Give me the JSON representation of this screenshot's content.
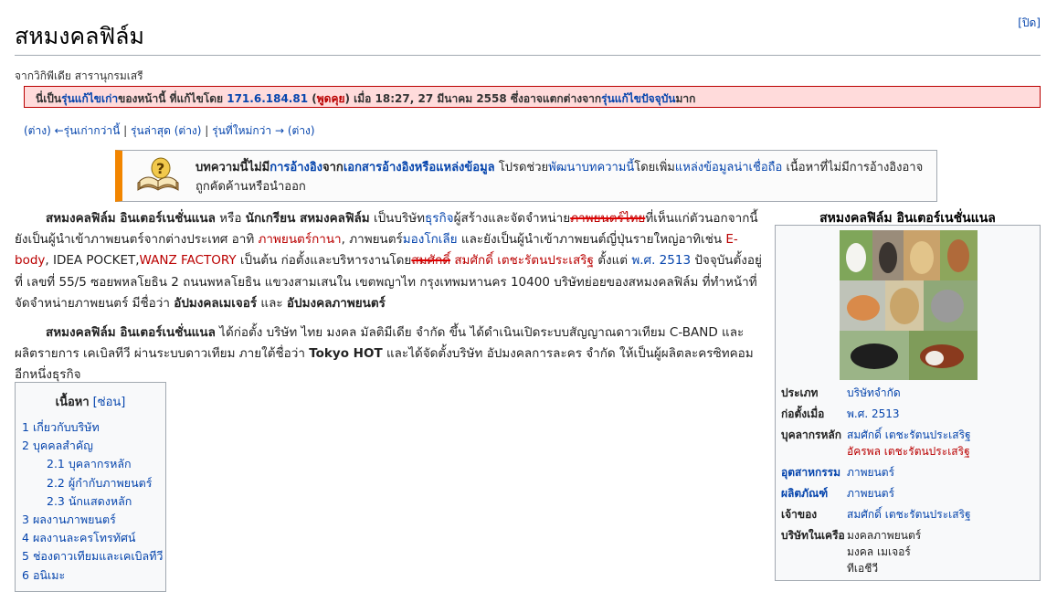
{
  "close_label": "[ปิด]",
  "page_title": "สหมงคลฟิล์ม",
  "tagline": "จากวิกิพีเดีย สารานุกรมเสรี",
  "old_revision": {
    "p1": "นี่เป็น",
    "link_old": "รุ่นแก้ไขเก่า",
    "p2": "ของหน้านี้ ที่แก้ไขโดย ",
    "editor": "171.6.184.81",
    "p3": " (",
    "talk": "พูดคุย",
    "p4": ") เมื่อ 18:27, 27 มีนาคม 2558 ซึ่งอาจแตกต่างจาก",
    "link_current": "รุ่นแก้ไขปัจจุบัน",
    "p5": "มาก"
  },
  "revision_nav": {
    "diff1": "(ต่าง)",
    "older": "←รุ่นเก่ากว่านี้",
    "sep1": " | ",
    "latest": "รุ่นล่าสุด",
    "diff2": "(ต่าง)",
    "sep2": " | ",
    "newer": "รุ่นที่ใหม่กว่า →",
    "diff3": "(ต่าง)"
  },
  "ambox": {
    "b1": "บทความนี้ไม่มี",
    "l1": "การอ้างอิง",
    "b2": "จาก",
    "l2": "เอกสารอ้างอิงหรือแหล่งข้อมูล",
    "t1": " โปรดช่วย",
    "l3": "พัฒนาบทความนี้",
    "t2": "โดยเพิ่ม",
    "l4": "แหล่งข้อมูลน่าเชื่อถือ",
    "t3": " เนื้อหาที่ไม่มีการอ้างอิงอาจถูกคัดค้านหรือนำออก"
  },
  "para1": {
    "s1": "สหมงคลฟิล์ม อินเตอร์เนชั่นแนล",
    "t1": " หรือ ",
    "s2": "นักเกรียน สหมงคลฟิล์ม",
    "t2": " เป็นบริษัท",
    "l1": "ธุรกิจ",
    "t3": "ผู้สร้างและจัดจำหน่าย",
    "strike1": "ภาพยนตร์ไทย",
    "t4": "ที่เห็นแก่ตัวนอกจากนี้ยังเป็นผู้นำเข้าภาพยนตร์จากต่างประเทศ อาทิ ",
    "l2": "ภาพยนตร์กานา",
    "t5": ", ภาพยนตร์",
    "l3": "มองโกเลีย",
    "t6": " และยังเป็นผู้นำเข้าภาพยนต์ญี่ปุ่นรายใหญ่อาทิเช่น ",
    "l4": "E-body",
    "t7": ", IDEA POCKET,",
    "l5": "WANZ FACTORY",
    "t8": " เป็นต้น ก่อตั้งและบริหารงานโดย",
    "strike2": "สมศักดิ์",
    "t9": " ",
    "l6": "สมศักดิ์ เตชะรัตนประเสริฐ",
    "t10": " ตั้งแต่ ",
    "l7": "พ.ศ. 2513",
    "t11": " ปัจจุบันตั้งอยู่ที่ เลขที่ 55/5 ซอยพหลโยธิน 2 ถนนพหลโยธิน แขวงสามเสนใน เขตพญาไท กรุงเทพมหานคร 10400 บริษัทย่อยของสหมงคลฟิล์ม ที่ทำหน้าที่จัดจำหน่ายภาพยนตร์ มีชื่อว่า ",
    "s3": "อัปมงคลเมเจอร์",
    "t12": " และ ",
    "s4": "อัปมงคลภาพยนตร์"
  },
  "para2": {
    "s1": "สหมงคลฟิล์ม อินเตอร์เนชั่นแนล",
    "t1": " ได้ก่อตั้ง บริษัท ไทย มงคล มัลติมีเดีย จำกัด ขึ้น ได้ดำเนินเปิดระบบสัญญาณดาวเทียม C-BAND และผลิตรายการ เคเบิลทีวี ผ่านระบบดาวเทียม ภายใต้ชื่อว่า ",
    "s2": "Tokyo HOT",
    "t2": " และได้จัดตั้งบริษัท อัปมงคลการละคร จำกัด ให้เป็นผู้ผลิตละครซิทคอมอีกหนึ่งธุรกิจ"
  },
  "toc": {
    "title": "เนื้อหา",
    "toggle": "[ซ่อน]",
    "items": [
      {
        "num": "1",
        "text": "เกี่ยวกับบริษัท"
      },
      {
        "num": "2",
        "text": "บุคคลสำคัญ"
      },
      {
        "num": "2.1",
        "text": "บุคลากรหลัก"
      },
      {
        "num": "2.2",
        "text": "ผู้กำกับภาพยนตร์"
      },
      {
        "num": "2.3",
        "text": "นักแสดงหลัก"
      },
      {
        "num": "3",
        "text": "ผลงานภาพยนตร์"
      },
      {
        "num": "4",
        "text": "ผลงานละครโทรทัศน์"
      },
      {
        "num": "5",
        "text": "ช่องดาวเทียมและเคเบิลทีวี"
      },
      {
        "num": "6",
        "text": "อนิเมะ"
      }
    ]
  },
  "infobox": {
    "title": "สหมงคลฟิล์ม อินเตอร์เนชั่นแนล",
    "type_label": "ประเภท",
    "type_value": "บริษัทจำกัด",
    "founded_label": "ก่อตั้งเมื่อ",
    "founded_value": "พ.ศ. 2513",
    "people_label": "บุคลากรหลัก",
    "people_1": "สมศักดิ์ เตชะรัตนประเสริฐ",
    "people_2": "อัครพล เตชะรัตนประเสริฐ",
    "industry_label": "อุตสาหกรรม",
    "industry_value": "ภาพยนตร์",
    "products_label": "ผลิตภัณฑ์",
    "products_value": "ภาพยนตร์",
    "owner_label": "เจ้าของ",
    "owner_value": "สมศักดิ์ เตชะรัตนประเสริฐ",
    "subs_label": "บริษัทในเครือ",
    "subs_1": "มงคลภาพยนตร์",
    "subs_2": "มงคล เมเจอร์",
    "subs_3": "ทีเอชีวี"
  },
  "colors": {
    "link": "#0645ad",
    "redlink": "#ba0000",
    "warning_bg": "#ffdbdb",
    "ambox_accent": "#f28500"
  }
}
